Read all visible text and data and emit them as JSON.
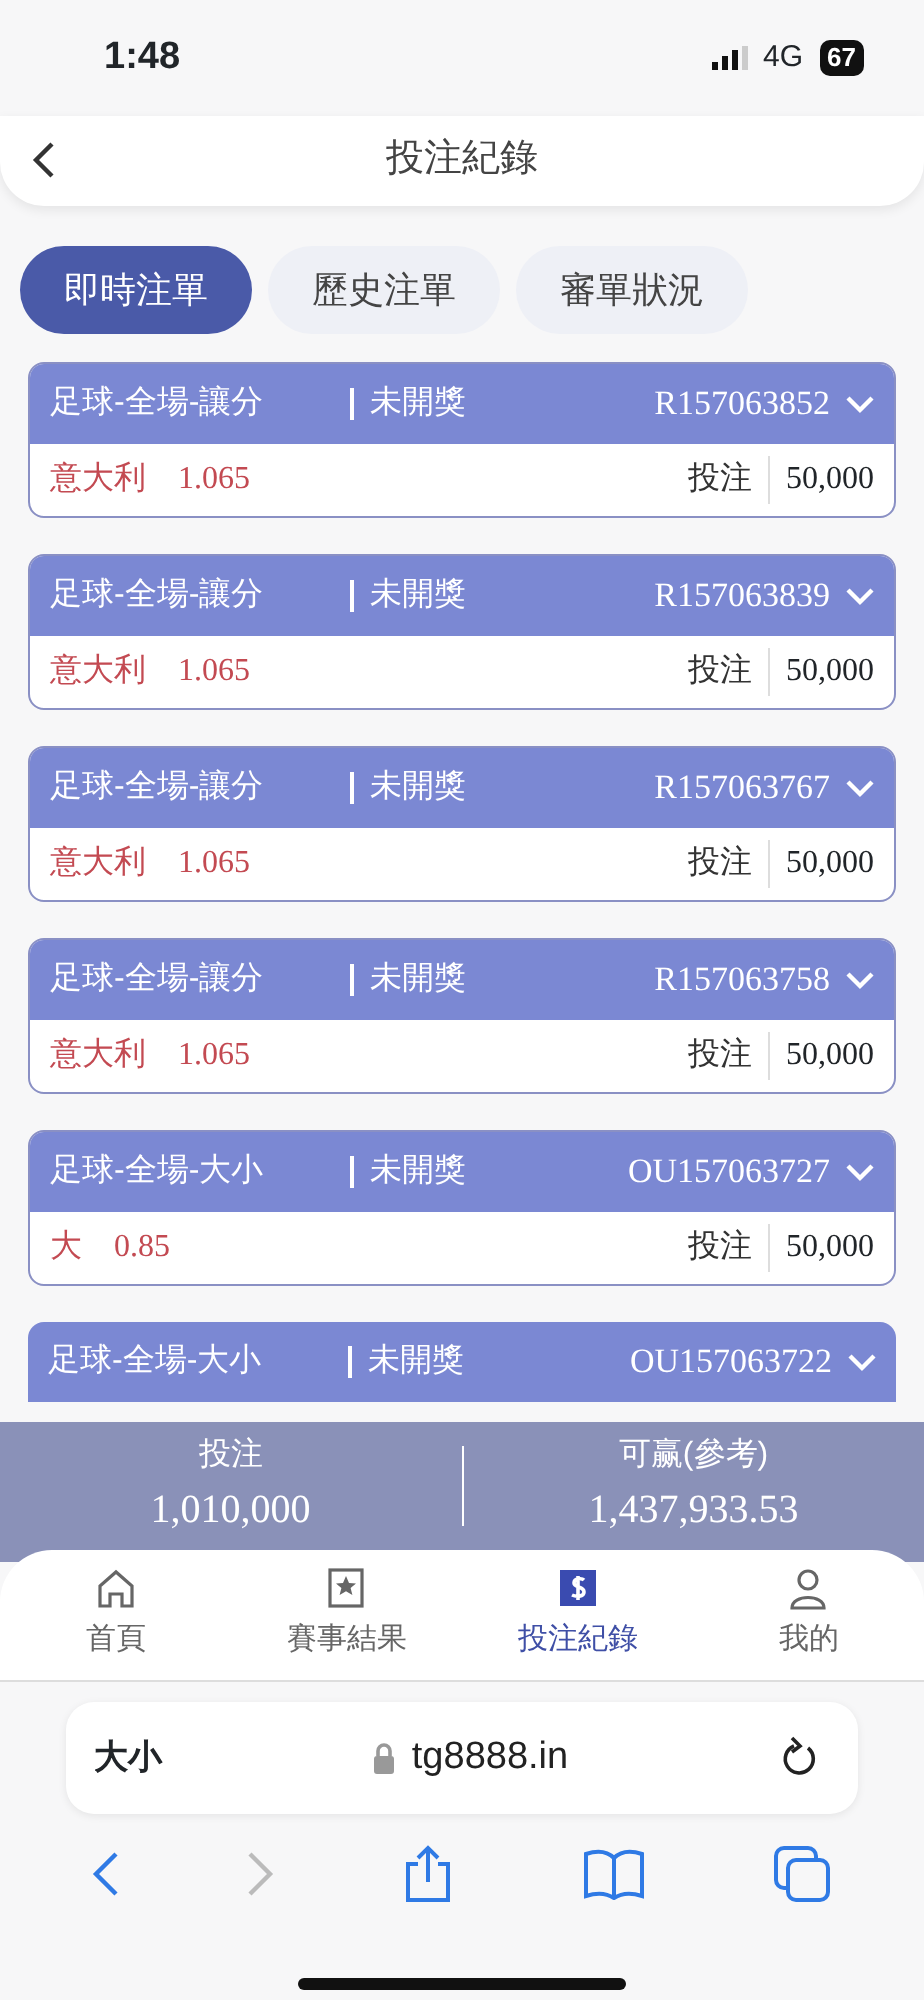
{
  "status_bar": {
    "time": "1:48",
    "network": "4G",
    "battery": "67"
  },
  "header": {
    "title": "投注紀錄"
  },
  "tabs": [
    {
      "label": "即時注單",
      "selected": true
    },
    {
      "label": "歷史注單",
      "selected": false
    },
    {
      "label": "審單狀況",
      "selected": false
    }
  ],
  "bets": [
    {
      "market": "足球-全場-讓分",
      "status": "未開獎",
      "ticket": "R157063852",
      "pick": "意大利",
      "odds": "1.065",
      "stake_label": "投注",
      "stake": "50,000"
    },
    {
      "market": "足球-全場-讓分",
      "status": "未開獎",
      "ticket": "R157063839",
      "pick": "意大利",
      "odds": "1.065",
      "stake_label": "投注",
      "stake": "50,000"
    },
    {
      "market": "足球-全場-讓分",
      "status": "未開獎",
      "ticket": "R157063767",
      "pick": "意大利",
      "odds": "1.065",
      "stake_label": "投注",
      "stake": "50,000"
    },
    {
      "market": "足球-全場-讓分",
      "status": "未開獎",
      "ticket": "R157063758",
      "pick": "意大利",
      "odds": "1.065",
      "stake_label": "投注",
      "stake": "50,000"
    },
    {
      "market": "足球-全場-大小",
      "status": "未開獎",
      "ticket": "OU157063727",
      "pick": "大",
      "odds": "0.85",
      "stake_label": "投注",
      "stake": "50,000"
    },
    {
      "market": "足球-全場-大小",
      "status": "未開獎",
      "ticket": "OU157063722"
    }
  ],
  "summary": [
    {
      "label": "投注",
      "value": "1,010,000"
    },
    {
      "label": "可赢(參考)",
      "value": "1,437,933.53"
    }
  ],
  "bottom_nav": [
    {
      "label": "首頁",
      "kind": "home",
      "selected": false
    },
    {
      "label": "賽事結果",
      "kind": "results",
      "selected": false
    },
    {
      "label": "投注紀錄",
      "kind": "bets",
      "selected": true
    },
    {
      "label": "我的",
      "kind": "profile",
      "selected": false
    }
  ],
  "browser": {
    "text_size": "大小",
    "url": "tg8888.in"
  }
}
